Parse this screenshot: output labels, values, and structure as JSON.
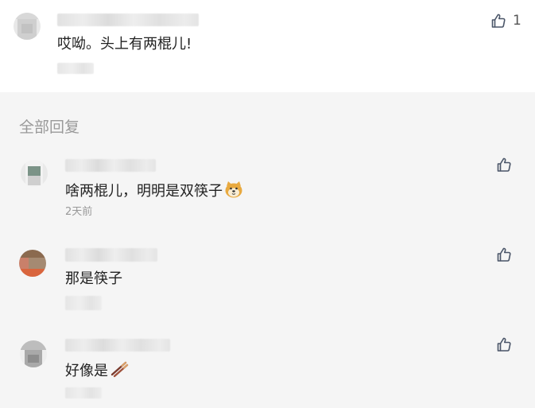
{
  "top_comment": {
    "text": "哎呦。头上有两棍儿!",
    "like_count": "1"
  },
  "replies_section": {
    "title": "全部回复"
  },
  "replies": [
    {
      "text": "啥两棍儿，明明是双筷子",
      "emoji": "doge-emoji-icon",
      "date": "2天前"
    },
    {
      "text": "那是筷子"
    },
    {
      "text": "好像是",
      "emoji": "chopsticks-emoji-icon"
    }
  ],
  "icons": {
    "like": "thumbs-up-icon"
  },
  "colors": {
    "like_icon": "#4a5568",
    "secondary_text": "#999999",
    "replies_background": "#f5f5f5"
  }
}
